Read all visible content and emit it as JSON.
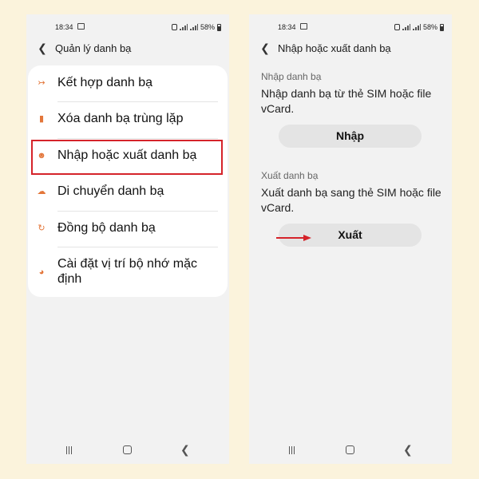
{
  "status_bar": {
    "time": "18:34",
    "battery": "58%"
  },
  "left_screen": {
    "header_title": "Quản lý danh bạ",
    "menu_items": [
      {
        "label": "Kết hợp danh bạ",
        "icon": "merge-icon"
      },
      {
        "label": "Xóa danh bạ trùng lặp",
        "icon": "remove-duplicates-icon"
      },
      {
        "label": "Nhập hoặc xuất danh bạ",
        "icon": "import-export-icon",
        "highlighted": true
      },
      {
        "label": "Di chuyển danh bạ",
        "icon": "move-cloud-icon"
      },
      {
        "label": "Đồng bộ danh bạ",
        "icon": "sync-icon"
      },
      {
        "label": "Cài đặt vị trí bộ nhớ mặc định",
        "icon": "storage-location-icon"
      }
    ]
  },
  "right_screen": {
    "header_title": "Nhập hoặc xuất danh bạ",
    "import_section": {
      "label": "Nhập danh bạ",
      "description": "Nhập danh bạ từ thẻ SIM hoặc file vCard.",
      "button": "Nhập"
    },
    "export_section": {
      "label": "Xuất danh bạ",
      "description": "Xuất danh bạ sang thẻ SIM hoặc file vCard.",
      "button": "Xuất"
    }
  },
  "colors": {
    "background": "#fbf3dc",
    "accent": "#e3763a",
    "highlight": "#d5232a"
  }
}
